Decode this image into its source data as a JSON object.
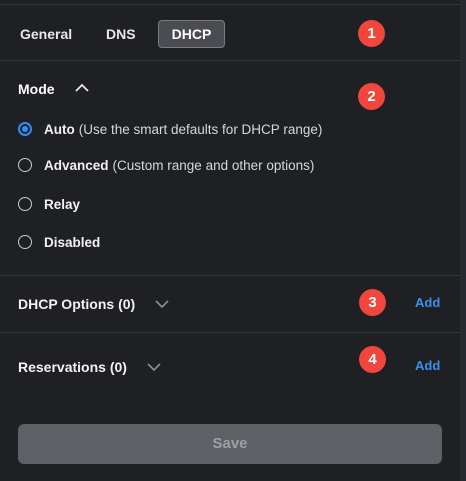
{
  "tabs": [
    {
      "label": "General",
      "active": false
    },
    {
      "label": "DNS",
      "active": false
    },
    {
      "label": "DHCP",
      "active": true
    }
  ],
  "badges": [
    "1",
    "2",
    "3",
    "4"
  ],
  "mode": {
    "title": "Mode",
    "expanded": true,
    "options": [
      {
        "label": "Auto",
        "desc": "(Use the smart defaults for DHCP range)",
        "selected": true
      },
      {
        "label": "Advanced",
        "desc": "(Custom range and other options)",
        "selected": false
      },
      {
        "label": "Relay",
        "desc": "",
        "selected": false
      },
      {
        "label": "Disabled",
        "desc": "",
        "selected": false
      }
    ]
  },
  "dhcp_options": {
    "title": "DHCP Options (0)",
    "add_label": "Add"
  },
  "reservations": {
    "title": "Reservations (0)",
    "add_label": "Add"
  },
  "save_label": "Save",
  "colors": {
    "accent": "#2f8ff5",
    "badge": "#f0463c",
    "link": "#3c8ff0"
  }
}
